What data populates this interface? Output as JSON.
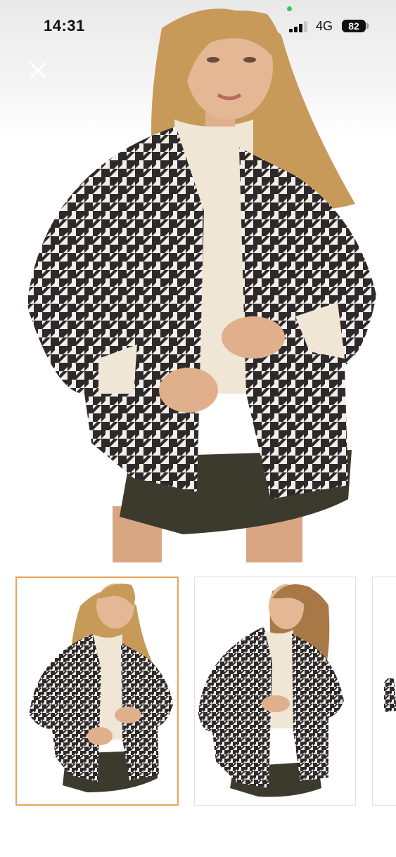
{
  "status_bar": {
    "time": "14:31",
    "network": "4G",
    "battery": "82"
  },
  "viewer": {
    "close_icon": "close-icon",
    "gallery": {
      "selected_index": 0,
      "thumbnails": [
        {
          "name": "thumbnail-1",
          "selected": true
        },
        {
          "name": "thumbnail-2",
          "selected": false
        },
        {
          "name": "thumbnail-3",
          "selected": false
        }
      ]
    }
  },
  "colors": {
    "selected_border": "#e8a55b",
    "houndstooth_dark": "#2e2a2c",
    "houndstooth_light": "#f3eee8",
    "sweater": "#efe6d6",
    "skirt": "#3b3a2c",
    "hair": "#c89a5a",
    "skin": "#e0b08c"
  }
}
